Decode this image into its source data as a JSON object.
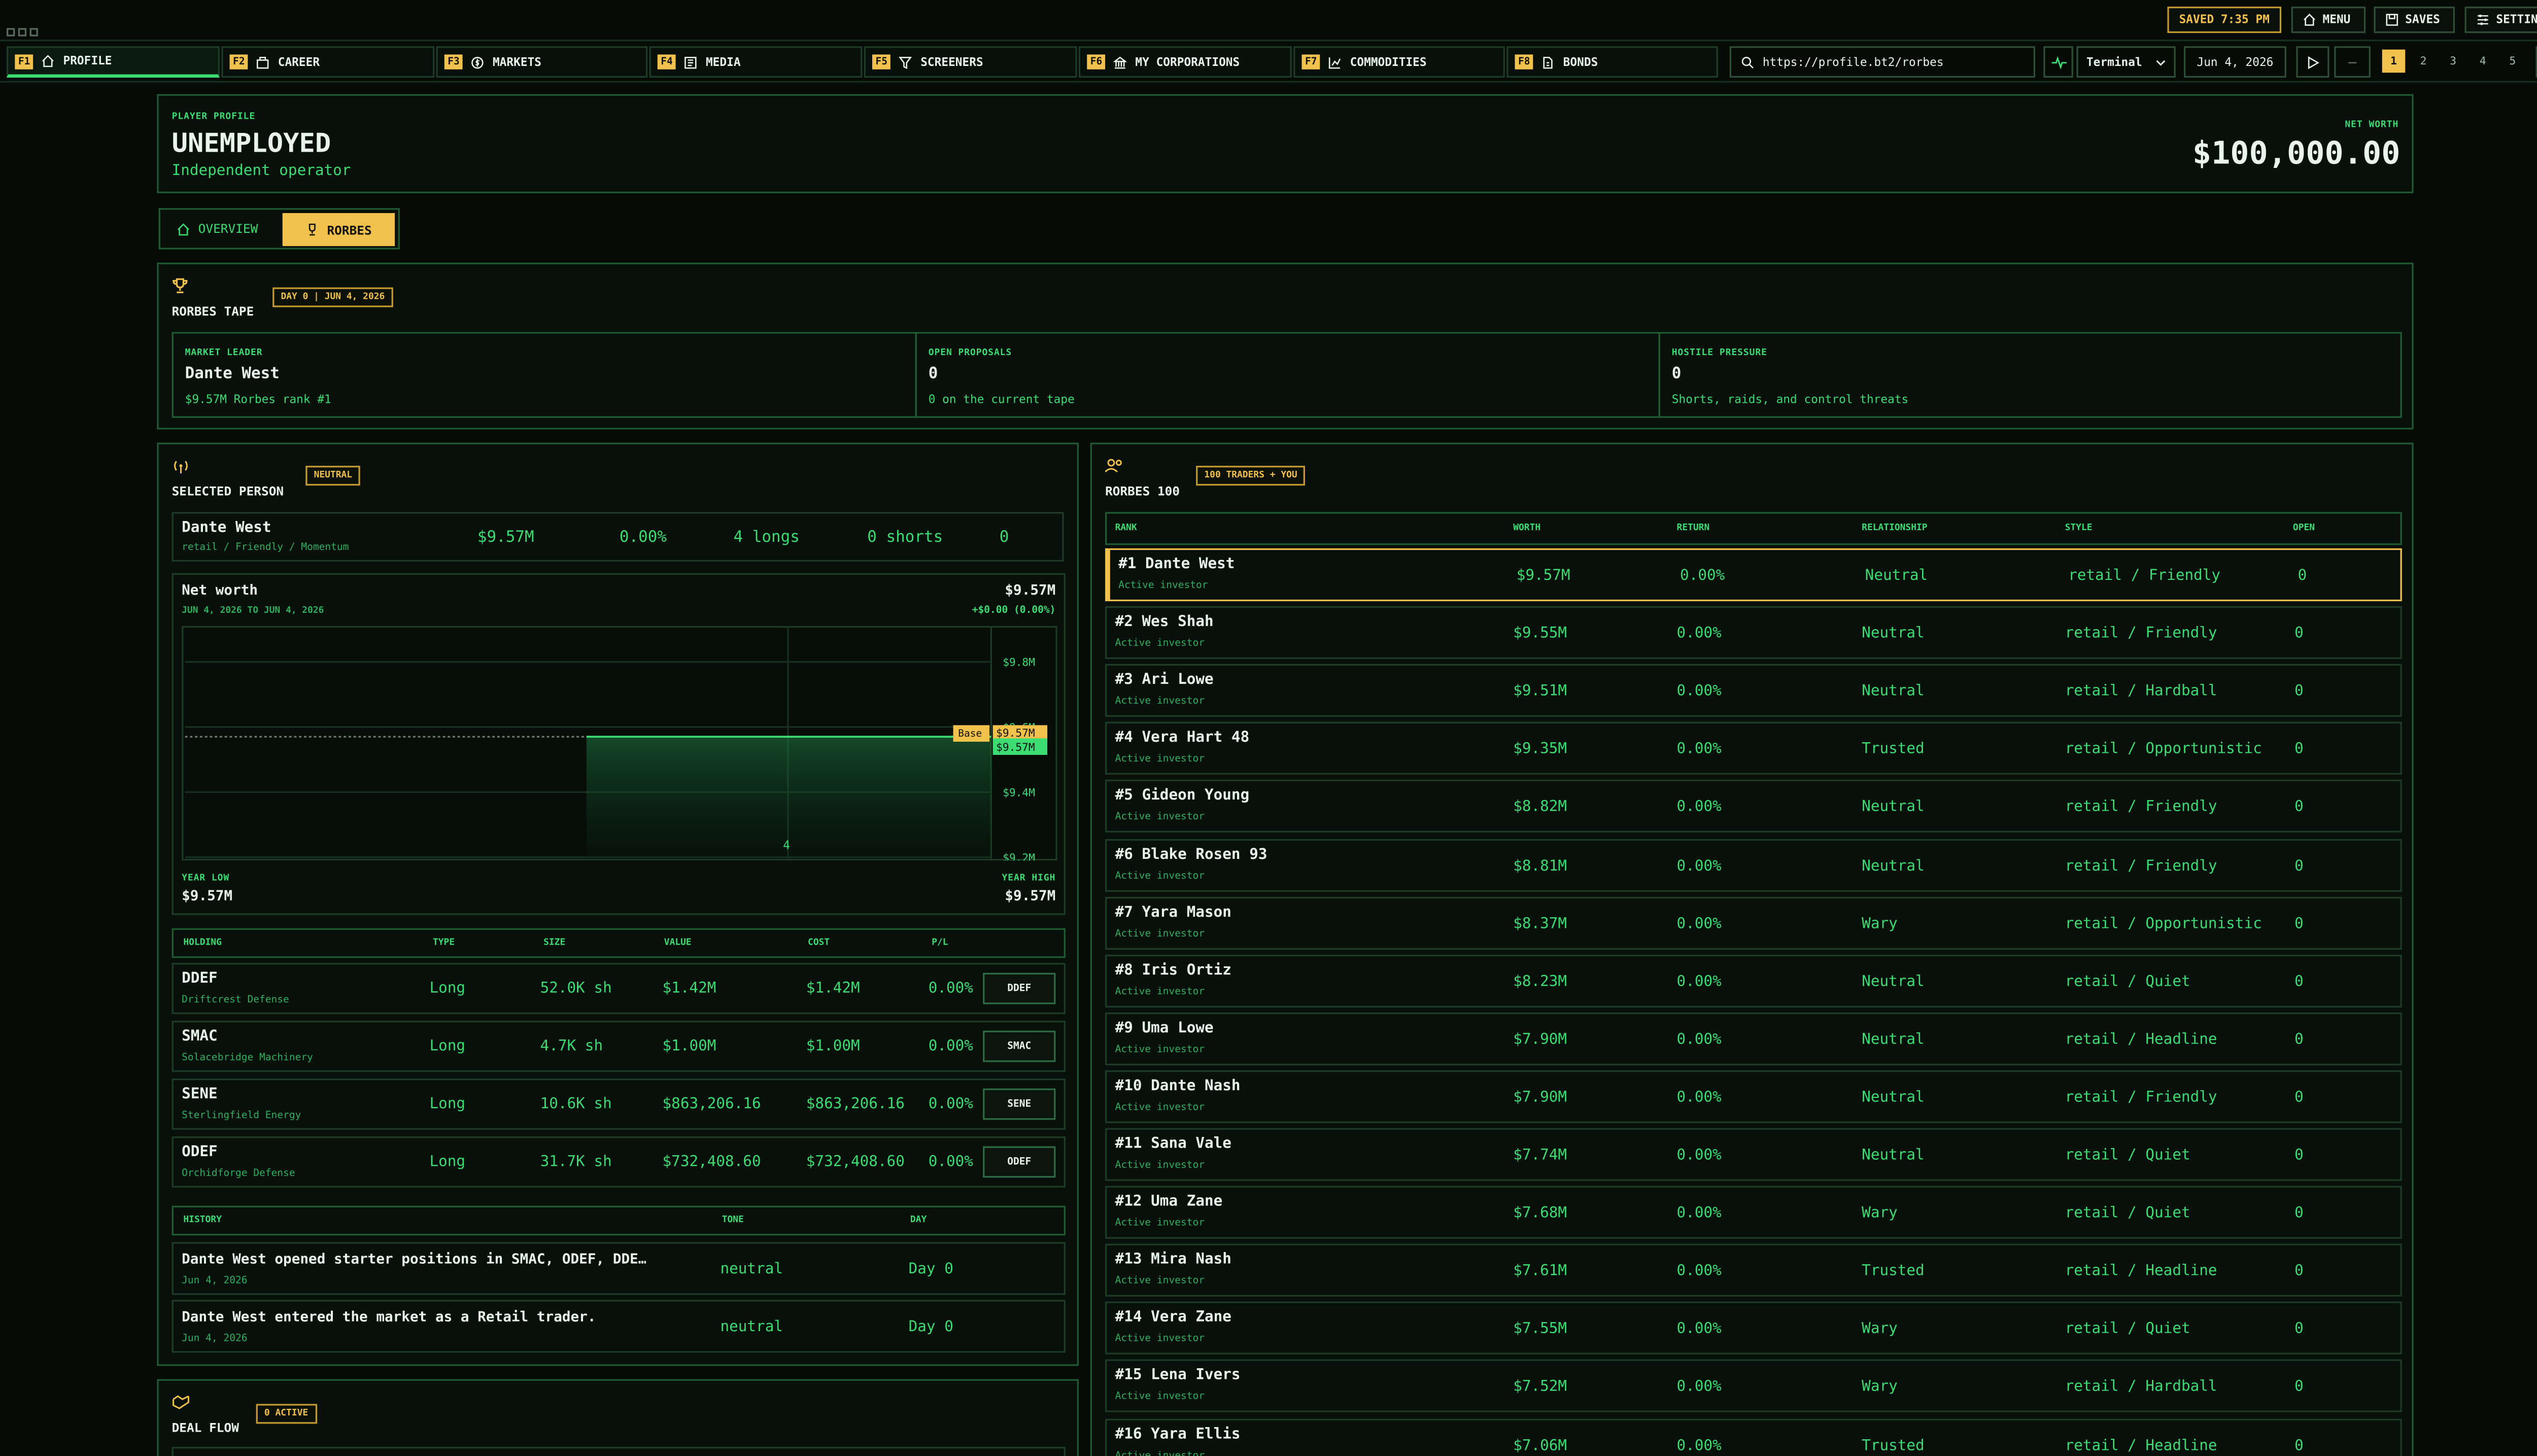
{
  "app": {
    "saved_label": "SAVED 7:35 PM",
    "menu_label": "MENU",
    "saves_label": "SAVES",
    "settings_label": "SETTINGS"
  },
  "tabs": [
    {
      "key": "F1",
      "label": "PROFILE",
      "icon": "home-icon"
    },
    {
      "key": "F2",
      "label": "CAREER",
      "icon": "briefcase-icon"
    },
    {
      "key": "F3",
      "label": "MARKETS",
      "icon": "dollar-icon"
    },
    {
      "key": "F4",
      "label": "MEDIA",
      "icon": "newspaper-icon"
    },
    {
      "key": "F5",
      "label": "SCREENERS",
      "icon": "filter-icon"
    },
    {
      "key": "F6",
      "label": "MY CORPORATIONS",
      "icon": "bank-icon"
    },
    {
      "key": "F7",
      "label": "COMMODITIES",
      "icon": "chart-icon"
    },
    {
      "key": "F8",
      "label": "BONDS",
      "icon": "document-icon"
    }
  ],
  "address": {
    "url": "https://profile.bt2/rorbes",
    "mode": "Terminal",
    "date": "Jun 4, 2026"
  },
  "pages": [
    "1",
    "2",
    "3",
    "4",
    "5"
  ],
  "profile": {
    "kicker": "PLAYER PROFILE",
    "title": "UNEMPLOYED",
    "subtitle": "Independent operator",
    "net_worth_label": "NET WORTH",
    "net_worth": "$100,000.00"
  },
  "subtabs": {
    "overview": "OVERVIEW",
    "rorbes": "RORBES"
  },
  "tape": {
    "title": "RORBES TAPE",
    "badge": "DAY 0 | JUN 4, 2026",
    "cells": [
      {
        "label": "MARKET LEADER",
        "value": "Dante West",
        "note": "$9.57M Rorbes rank #1"
      },
      {
        "label": "OPEN PROPOSALS",
        "value": "0",
        "note": "0 on the current tape"
      },
      {
        "label": "HOSTILE PRESSURE",
        "value": "0",
        "note": "Shorts, raids, and control threats"
      }
    ]
  },
  "selected": {
    "title": "SELECTED PERSON",
    "badge": "NEUTRAL",
    "name": "Dante West",
    "style": "retail / Friendly / Momentum",
    "worth": "$9.57M",
    "ret": "0.00%",
    "longs": "4 longs",
    "shorts": "0 shorts",
    "open": "0"
  },
  "networth_chart": {
    "title": "Net worth",
    "value": "$9.57M",
    "range": "JUN 4, 2026 TO JUN 4, 2026",
    "change": "+$0.00 (0.00%)",
    "base_label": "Base",
    "base_value": "$9.57M",
    "current_value": "$9.57M",
    "xtick": "4",
    "year_low_label": "YEAR LOW",
    "year_low": "$9.57M",
    "year_high_label": "YEAR HIGH",
    "year_high": "$9.57M"
  },
  "chart_data": {
    "type": "area",
    "title": "Net worth",
    "x": [
      "4"
    ],
    "series": [
      {
        "values": [
          9.57
        ]
      }
    ],
    "ylim": [
      9.2,
      9.9
    ],
    "yticks": [
      "$9.8M",
      "$9.6M",
      "$9.4M",
      "$9.2M"
    ],
    "ytick_values": [
      9.8,
      9.6,
      9.4,
      9.2
    ],
    "base": 9.57,
    "grid": true
  },
  "holdings": {
    "headers": [
      "HOLDING",
      "TYPE",
      "SIZE",
      "VALUE",
      "COST",
      "P/L"
    ],
    "rows": [
      {
        "ticker": "DDEF",
        "name": "Driftcrest Defense",
        "type": "Long",
        "size": "52.0K sh",
        "value": "$1.42M",
        "cost": "$1.42M",
        "pl": "0.00%",
        "btn": "DDEF"
      },
      {
        "ticker": "SMAC",
        "name": "Solacebridge Machinery",
        "type": "Long",
        "size": "4.7K sh",
        "value": "$1.00M",
        "cost": "$1.00M",
        "pl": "0.00%",
        "btn": "SMAC"
      },
      {
        "ticker": "SENE",
        "name": "Sterlingfield Energy",
        "type": "Long",
        "size": "10.6K sh",
        "value": "$863,206.16",
        "cost": "$863,206.16",
        "pl": "0.00%",
        "btn": "SENE"
      },
      {
        "ticker": "ODEF",
        "name": "Orchidforge Defense",
        "type": "Long",
        "size": "31.7K sh",
        "value": "$732,408.60",
        "cost": "$732,408.60",
        "pl": "0.00%",
        "btn": "ODEF"
      }
    ]
  },
  "history": {
    "headers": [
      "HISTORY",
      "TONE",
      "DAY"
    ],
    "rows": [
      {
        "text": "Dante West opened starter positions in SMAC, ODEF, DDE…",
        "date": "Jun 4, 2026",
        "tone": "neutral",
        "day": "Day 0"
      },
      {
        "text": "Dante West entered the market as a Retail trader.",
        "date": "Jun 4, 2026",
        "tone": "neutral",
        "day": "Day 0"
      }
    ]
  },
  "deal_flow": {
    "title": "DEAL FLOW",
    "badge": "0 ACTIVE"
  },
  "rorbes100": {
    "title": "RORBES 100",
    "badge": "100 TRADERS + YOU",
    "headers": [
      "RANK",
      "WORTH",
      "RETURN",
      "RELATIONSHIP",
      "STYLE",
      "OPEN"
    ],
    "rows": [
      {
        "rank": "#1 Dante West",
        "sub": "Active investor",
        "worth": "$9.57M",
        "ret": "0.00%",
        "rel": "Neutral",
        "style": "retail / Friendly",
        "open": "0"
      },
      {
        "rank": "#2 Wes Shah",
        "sub": "Active investor",
        "worth": "$9.55M",
        "ret": "0.00%",
        "rel": "Neutral",
        "style": "retail / Friendly",
        "open": "0"
      },
      {
        "rank": "#3 Ari Lowe",
        "sub": "Active investor",
        "worth": "$9.51M",
        "ret": "0.00%",
        "rel": "Neutral",
        "style": "retail / Hardball",
        "open": "0"
      },
      {
        "rank": "#4 Vera Hart 48",
        "sub": "Active investor",
        "worth": "$9.35M",
        "ret": "0.00%",
        "rel": "Trusted",
        "style": "retail / Opportunistic",
        "open": "0"
      },
      {
        "rank": "#5 Gideon Young",
        "sub": "Active investor",
        "worth": "$8.82M",
        "ret": "0.00%",
        "rel": "Neutral",
        "style": "retail / Friendly",
        "open": "0"
      },
      {
        "rank": "#6 Blake Rosen 93",
        "sub": "Active investor",
        "worth": "$8.81M",
        "ret": "0.00%",
        "rel": "Neutral",
        "style": "retail / Friendly",
        "open": "0"
      },
      {
        "rank": "#7 Yara Mason",
        "sub": "Active investor",
        "worth": "$8.37M",
        "ret": "0.00%",
        "rel": "Wary",
        "style": "retail / Opportunistic",
        "open": "0"
      },
      {
        "rank": "#8 Iris Ortiz",
        "sub": "Active investor",
        "worth": "$8.23M",
        "ret": "0.00%",
        "rel": "Neutral",
        "style": "retail / Quiet",
        "open": "0"
      },
      {
        "rank": "#9 Uma Lowe",
        "sub": "Active investor",
        "worth": "$7.90M",
        "ret": "0.00%",
        "rel": "Neutral",
        "style": "retail / Headline",
        "open": "0"
      },
      {
        "rank": "#10 Dante Nash",
        "sub": "Active investor",
        "worth": "$7.90M",
        "ret": "0.00%",
        "rel": "Neutral",
        "style": "retail / Friendly",
        "open": "0"
      },
      {
        "rank": "#11 Sana Vale",
        "sub": "Active investor",
        "worth": "$7.74M",
        "ret": "0.00%",
        "rel": "Neutral",
        "style": "retail / Quiet",
        "open": "0"
      },
      {
        "rank": "#12 Uma Zane",
        "sub": "Active investor",
        "worth": "$7.68M",
        "ret": "0.00%",
        "rel": "Wary",
        "style": "retail / Quiet",
        "open": "0"
      },
      {
        "rank": "#13 Mira Nash",
        "sub": "Active investor",
        "worth": "$7.61M",
        "ret": "0.00%",
        "rel": "Trusted",
        "style": "retail / Headline",
        "open": "0"
      },
      {
        "rank": "#14 Vera Zane",
        "sub": "Active investor",
        "worth": "$7.55M",
        "ret": "0.00%",
        "rel": "Wary",
        "style": "retail / Quiet",
        "open": "0"
      },
      {
        "rank": "#15 Lena Ivers",
        "sub": "Active investor",
        "worth": "$7.52M",
        "ret": "0.00%",
        "rel": "Wary",
        "style": "retail / Hardball",
        "open": "0"
      },
      {
        "rank": "#16 Yara Ellis",
        "sub": "Active investor",
        "worth": "$7.06M",
        "ret": "0.00%",
        "rel": "Trusted",
        "style": "retail / Headline",
        "open": "0"
      }
    ]
  },
  "colors": {
    "accent": "#3ddc73",
    "highlight": "#f2c14b",
    "background": "#060b07",
    "border": "#1f5a33"
  }
}
